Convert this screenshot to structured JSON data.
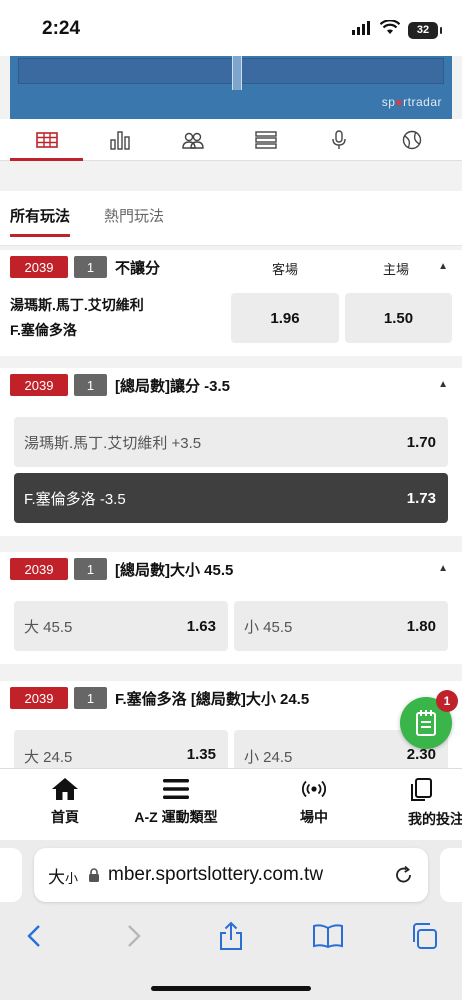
{
  "status": {
    "time": "2:24",
    "battery": "32"
  },
  "banner": {
    "brand_prefix": "sp",
    "brand_dot": "●",
    "brand_suffix": "rtradar"
  },
  "icon_tabs": [
    "scoreboard-icon",
    "stats-icon",
    "lineup-icon",
    "list-icon",
    "microphone-icon",
    "ball-icon"
  ],
  "filters": {
    "all": "所有玩法",
    "popular": "熱門玩法"
  },
  "markets": [
    {
      "game_no": "2039",
      "seq": "1",
      "title": "不讓分",
      "col_away": "客場",
      "col_home": "主場",
      "team1": "湯瑪斯.馬丁.艾切維利",
      "team2": "F.塞倫多洛",
      "odds": [
        {
          "label": "",
          "value": "1.96"
        },
        {
          "label": "",
          "value": "1.50"
        }
      ]
    },
    {
      "game_no": "2039",
      "seq": "1",
      "title": "[總局數]讓分 -3.5",
      "odds": [
        {
          "label": "湯瑪斯.馬丁.艾切維利 +3.5",
          "value": "1.70"
        },
        {
          "label": "F.塞倫多洛 -3.5",
          "value": "1.73"
        }
      ]
    },
    {
      "game_no": "2039",
      "seq": "1",
      "title": "[總局數]大小 45.5",
      "odds": [
        {
          "label": "大 45.5",
          "value": "1.63"
        },
        {
          "label": "小 45.5",
          "value": "1.80"
        }
      ]
    },
    {
      "game_no": "2039",
      "seq": "1",
      "title": "F.塞倫多洛 [總局數]大小 24.5",
      "odds": [
        {
          "label": "大 24.5",
          "value": "1.35"
        },
        {
          "label": "小 24.5",
          "value": "2.30"
        }
      ]
    }
  ],
  "chat": {
    "badge": "1"
  },
  "bottom_nav": [
    {
      "label": "首頁",
      "icon": "home-icon"
    },
    {
      "label": "A-Z 運動類型",
      "icon": "menu-icon"
    },
    {
      "label": "場中",
      "icon": "live-broadcast-icon"
    },
    {
      "label": "我的投注",
      "icon": "copy-icon"
    }
  ],
  "browser": {
    "aa_large": "大",
    "aa_small": "小",
    "url": "mber.sportslottery.com.tw"
  }
}
